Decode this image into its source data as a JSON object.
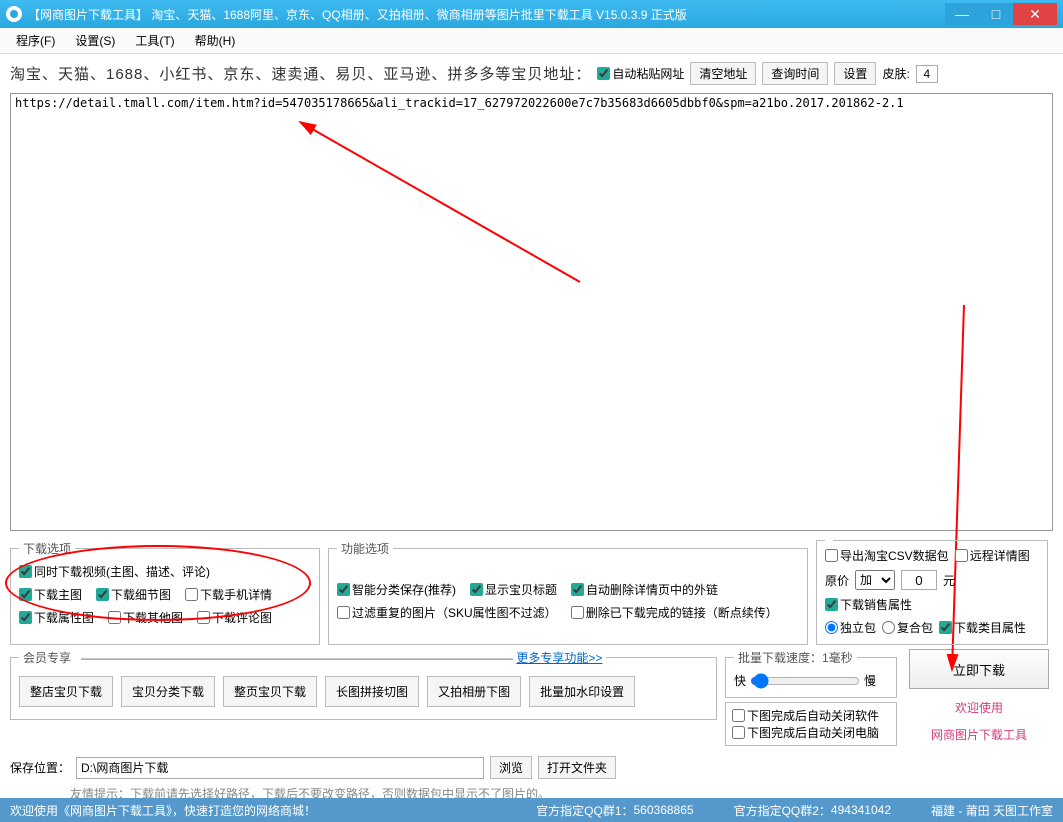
{
  "titlebar": {
    "title": "【网商图片下载工具】 淘宝、天猫、1688阿里、京东、QQ相册、又拍相册、微商相册等图片批里下载工具 V15.0.3.9 正式版"
  },
  "menu": {
    "program": "程序(F)",
    "settings": "设置(S)",
    "tools": "工具(T)",
    "help": "帮助(H)"
  },
  "top": {
    "label": "淘宝、天猫、1688、小红书、京东、速卖通、易贝、亚马逊、拼多多等宝贝地址：",
    "auto_paste": "自动粘贴网址",
    "clear": "清空地址",
    "query_time": "查询时间",
    "settings": "设置",
    "skin_label": "皮肤:",
    "skin_value": "4"
  },
  "url": "https://detail.tmall.com/item.htm?id=547035178665&ali_trackid=17_627972022600e7c7b35683d6605dbbf0&spm=a21bo.2017.201862-2.1",
  "opt": {
    "dl_legend": "下载选项",
    "video_together": "同时下载视频(主图、描述、评论)",
    "main_img": "下载主图",
    "detail_img": "下载细节图",
    "mobile_detail": "下载手机详情",
    "attr_img": "下载属性图",
    "other_img": "下载其他图",
    "comment_img": "下载评论图",
    "func_legend": "功能选项",
    "smart_save": "智能分类保存(推荐)",
    "show_title": "显示宝贝标题",
    "auto_del_outlink": "自动删除详情页中的外链",
    "filter_dup": "过滤重复的图片（SKU属性图不过滤）",
    "del_done": "删除已下载完成的链接（断点续传）",
    "export_csv": "导出淘宝CSV数据包",
    "remote_detail": "远程详情图",
    "price_label": "原价",
    "price_op": "加",
    "price_val": "0",
    "price_unit": "元",
    "dl_sale_attr": "下载销售属性",
    "pack_single": "独立包",
    "pack_combo": "复合包",
    "dl_cat_attr": "下载类目属性"
  },
  "vip": {
    "legend": "会员专享",
    "b1": "整店宝贝下载",
    "b2": "宝贝分类下载",
    "b3": "整页宝贝下载",
    "b4": "长图拼接切图",
    "b5": "又拍相册下图",
    "b6": "批量加水印设置",
    "more": "更多专享功能>>"
  },
  "speed": {
    "legend": "批量下载速度：1毫秒",
    "fast": "快",
    "slow": "慢",
    "auto_close_sw": "下图完成后自动关闭软件",
    "auto_close_pc": "下图完成后自动关闭电脑"
  },
  "action": {
    "download": "立即下载",
    "welcome": "欢迎使用",
    "toolname": "网商图片下载工具"
  },
  "path": {
    "label": "保存位置：",
    "value": "D:\\网商图片下载",
    "browse": "浏览",
    "open": "打开文件夹",
    "hint": "友情提示：下载前请先选择好路径，下载后不要改变路径，否则数据包中显示不了图片的。"
  },
  "status": {
    "welcome": "欢迎使用《网商图片下载工具》，快速打造您的网络商城！",
    "qq1_label": "官方指定QQ群1：",
    "qq1": "560368865",
    "qq2_label": "官方指定QQ群2：",
    "qq2": "494341042",
    "loc": "福建 - 莆田 天图工作室"
  }
}
